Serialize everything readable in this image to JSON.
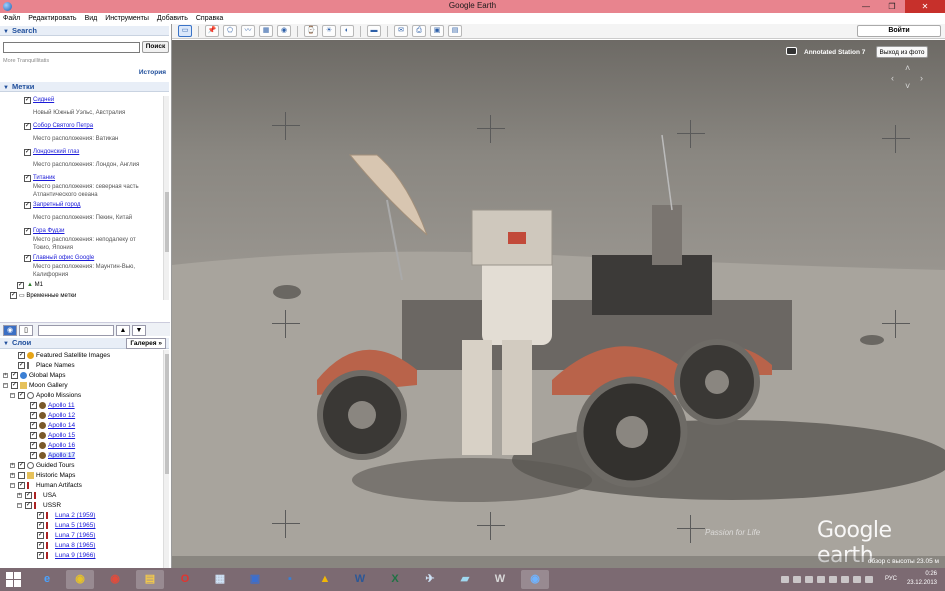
{
  "window": {
    "title": "Google Earth",
    "controls": [
      "—",
      "❐",
      "✕"
    ]
  },
  "menu": [
    "Файл",
    "Редактировать",
    "Вид",
    "Инструменты",
    "Добавить",
    "Справка"
  ],
  "toolbar": {
    "sign_in": "Войти"
  },
  "search": {
    "header": "Search",
    "button": "Поиск",
    "hint": "More Tranquillitatis",
    "history": "История"
  },
  "places": {
    "header": "Метки",
    "items": [
      {
        "name": "Сидней",
        "desc": "Новый Южный Уэльс, Австралия"
      },
      {
        "name": "Собор Святого Петра",
        "desc": "Место расположения: Ватикан"
      },
      {
        "name": "Лондонский глаз",
        "desc": "Место расположения: Лондон, Англия"
      },
      {
        "name": "Титаник",
        "desc": "Место расположения: северная часть\nАтлантического океана"
      },
      {
        "name": "Запретный город",
        "desc": "Место расположения: Пекин, Китай"
      },
      {
        "name": "Гора Фудзи",
        "desc": "Место расположения: неподалеку от\nТокио, Япония"
      },
      {
        "name": "Главный офис Google",
        "desc": "Место расположения: Маунтин-Вью,\nКалифорния"
      }
    ],
    "m1": "M1",
    "temp": "Временные метки"
  },
  "layers": {
    "header": "Слои",
    "gallery": "Галерея",
    "items": [
      {
        "name": "Featured Satellite Images"
      },
      {
        "name": "Place Names"
      },
      {
        "name": "Global Maps"
      },
      {
        "name": "Moon Gallery"
      },
      {
        "name": "Apollo Missions"
      },
      {
        "name": "Apollo 11"
      },
      {
        "name": "Apollo 12"
      },
      {
        "name": "Apollo 14"
      },
      {
        "name": "Apollo 15"
      },
      {
        "name": "Apollo 16"
      },
      {
        "name": "Apollo 17"
      },
      {
        "name": "Guided Tours"
      },
      {
        "name": "Historic Maps"
      },
      {
        "name": "Human Artifacts"
      },
      {
        "name": "USA"
      },
      {
        "name": "USSR"
      },
      {
        "name": "Luna 2 (1959)"
      },
      {
        "name": "Luna 5 (1965)"
      },
      {
        "name": "Luna 7 (1965)"
      },
      {
        "name": "Luna 8 (1965)"
      },
      {
        "name": "Luna 9 (1966)"
      }
    ]
  },
  "view": {
    "photo_label": "Annotated Station 7",
    "exit_photo": "Выход из фото",
    "logo": "Google earth",
    "altitude": "обзор с высоты  23.05 м",
    "watermark": "Passion for Life"
  },
  "taskbar": {
    "lang": "РУС",
    "time": "0:26",
    "date": "23.12.2013"
  },
  "colors": {
    "titlebar": "#e8848e",
    "taskbar": "#7c6a72",
    "section_header": "#1f4e9b",
    "link": "#1a1ad8"
  }
}
